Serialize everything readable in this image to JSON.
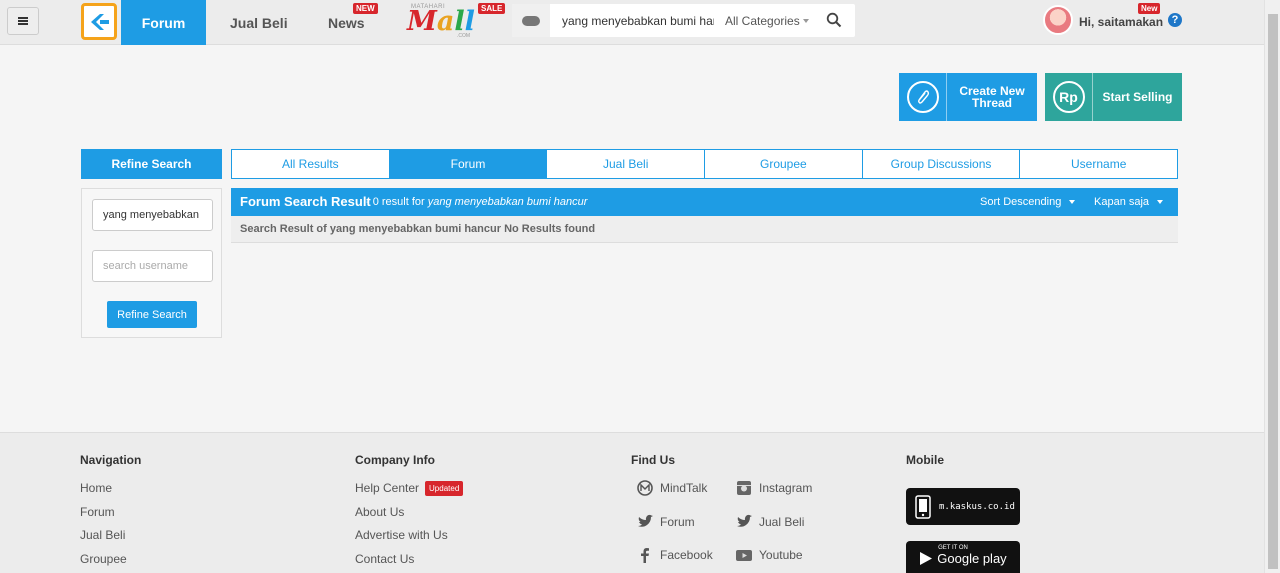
{
  "header": {
    "nav_forum": "Forum",
    "nav_jualbeli": "Jual Beli",
    "nav_news": "News",
    "news_badge": "NEW",
    "mall_top": "MATAHARI",
    "mall_word": [
      "M",
      "a",
      "l",
      "l"
    ],
    "mall_com": ".COM",
    "sale_badge": "SALE",
    "search_value": "yang menyebabkan bumi hancur",
    "category": "All Categories",
    "user_greeting": "Hi, saitamakan",
    "user_badge": "New",
    "help": "?"
  },
  "actions": {
    "create_thread": "Create New Thread",
    "start_selling": "Start Selling",
    "rp_icon": "Rp"
  },
  "refine": {
    "title": "Refine Search",
    "keyword_value": "yang menyebabkan bumi hancur",
    "username_placeholder": "search username",
    "button": "Refine Search"
  },
  "tabs": [
    "All Results",
    "Forum",
    "Jual Beli",
    "Groupee",
    "Group Discussions",
    "Username"
  ],
  "result": {
    "title": "Forum Search Result",
    "summary_prefix": "- 0 result for ",
    "query": "yang menyebabkan bumi hancur",
    "sort": "Sort Descending",
    "time": "Kapan saja",
    "message": "Search Result of yang menyebabkan bumi hancur No Results found"
  },
  "footer": {
    "navigation": {
      "title": "Navigation",
      "links": [
        "Home",
        "Forum",
        "Jual Beli",
        "Groupee"
      ]
    },
    "company": {
      "title": "Company Info",
      "links": [
        "Help Center",
        "About Us",
        "Advertise with Us",
        "Contact Us"
      ],
      "updated_badge": "Updated"
    },
    "find_us": {
      "title": "Find Us",
      "mindtalk": "MindTalk",
      "instagram": "Instagram",
      "forum": "Forum",
      "jualbeli": "Jual Beli",
      "facebook": "Facebook",
      "youtube": "Youtube"
    },
    "mobile": {
      "title": "Mobile",
      "site": "m.kaskus.co.id",
      "get_it_on": "GET IT ON",
      "store": "Google play"
    }
  }
}
